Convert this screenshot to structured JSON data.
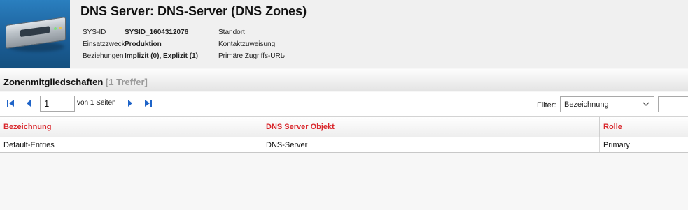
{
  "header": {
    "title": "DNS Server: DNS-Server (DNS Zones)",
    "fields": {
      "sysid_label": "SYS-ID",
      "sysid_value": "SYSID_1604312076",
      "purpose_label": "Einsatzzweck",
      "purpose_value": "Produktion",
      "relations_label": "Beziehungen",
      "relations_value": "Implizit (0), Explizit (1)",
      "location_label": "Standort",
      "location_value": "",
      "contact_label": "Kontaktzuweisung",
      "contact_value": "",
      "url_label": "Primäre Zugriffs-URL",
      "url_value": "-"
    }
  },
  "section": {
    "title": "Zonenmitgliedschaften",
    "count": "[1 Treffer]"
  },
  "pager": {
    "current_page": "1",
    "pages_text": "von 1 Seiten"
  },
  "filter": {
    "label": "Filter:",
    "selected": "Bezeichnung",
    "value": ""
  },
  "table": {
    "columns": [
      "Bezeichnung",
      "DNS Server Objekt",
      "Rolle"
    ],
    "rows": [
      [
        "Default-Entries",
        "DNS-Server",
        "Primary"
      ]
    ]
  },
  "colors": {
    "column_header_text": "#d9262b",
    "pager_icon": "#1f64c8",
    "section_count": "#9a9a9a"
  },
  "icons": {
    "first": "first-page-icon",
    "prev": "previous-page-icon",
    "next": "next-page-icon",
    "last": "last-page-icon",
    "select": "chevron-down-icon",
    "device": "dns-server-device-icon"
  }
}
